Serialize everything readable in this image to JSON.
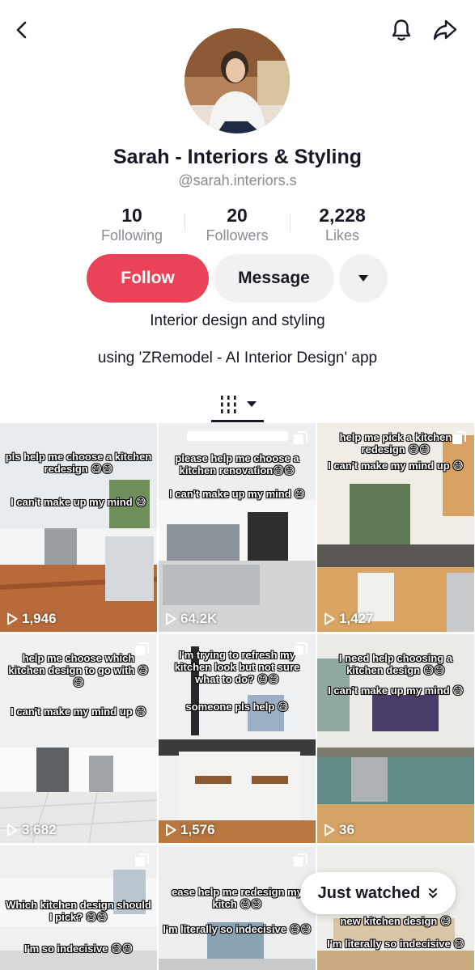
{
  "profile": {
    "name": "Sarah - Interiors & Styling",
    "handle": "@sarah.interiors.s",
    "bio_line1": "Interior design and styling",
    "bio_line2": "using 'ZRemodel - AI Interior Design' app"
  },
  "stats": [
    {
      "value": "10",
      "label": "Following"
    },
    {
      "value": "20",
      "label": "Followers"
    },
    {
      "value": "2,228",
      "label": "Likes"
    }
  ],
  "actions": {
    "follow_label": "Follow",
    "message_label": "Message"
  },
  "colors": {
    "follow_bg": "#ea4359",
    "text_primary": "#161823",
    "text_secondary": "#8a8b91"
  },
  "icons": [
    "back-arrow-icon",
    "bell-icon",
    "share-icon",
    "dropdown-icon",
    "videos-tab-icon",
    "play-icon",
    "multi-photo-icon",
    "double-chevron-down-icon"
  ],
  "videos": [
    {
      "caption1": "pls help me choose a kitchen redesign 😅😅",
      "caption2": "I can't make up my mind 😅",
      "views": "1,946"
    },
    {
      "caption1": "please help me choose a kitchen renovation😅😅",
      "caption2": "I can't make up my mind 😅",
      "views": "64.2K"
    },
    {
      "caption1": "help me pick a kitchen redesign 😅😅",
      "caption2": "I can't make my mind up 😅",
      "views": "1,427"
    },
    {
      "caption1": "help me choose which kitchen design to go with 😅😅",
      "caption2": "I can't make my mind up 😅",
      "views": "3,682"
    },
    {
      "caption1": "I'm trying to refresh my kitchen look but not sure what to do? 😅😅",
      "caption2": "someone pls help 😅",
      "views": "1,576"
    },
    {
      "caption1": "I need help choosing a kitchen design 😅😅",
      "caption2": "I can't make up my mind 😅",
      "views": "36"
    },
    {
      "caption1": "Which kitchen design should I pick? 😅😅",
      "caption2": "I'm so indecisive 😅😅",
      "views": ""
    },
    {
      "caption1": "ease help me redesign my kitch 😅😅",
      "caption2": "I'm literally so indecisive 😅😅",
      "views": ""
    },
    {
      "caption1": "new kitchen design 😅",
      "caption2": "I'm literally so indecisive 😅",
      "views": ""
    }
  ],
  "just_watched": {
    "label": "Just watched"
  }
}
